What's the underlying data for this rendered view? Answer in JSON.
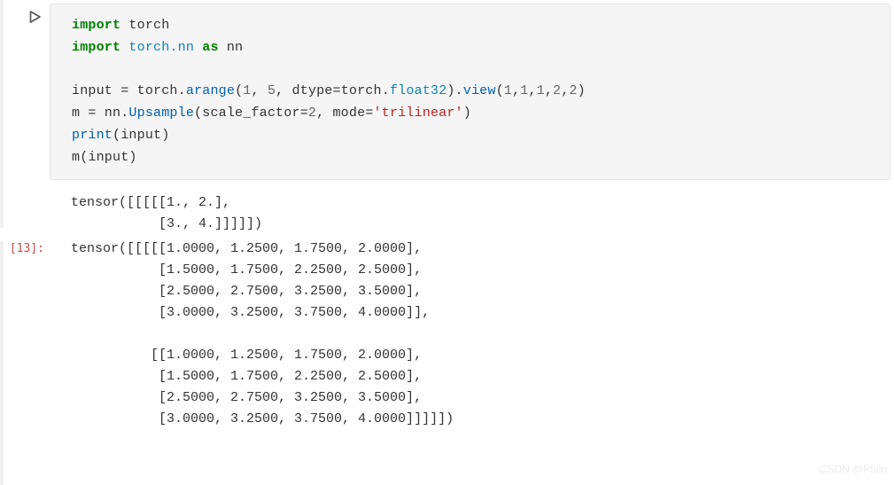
{
  "code": {
    "lines": [
      {
        "segments": [
          {
            "t": "import ",
            "c": "k-import"
          },
          {
            "t": "torch",
            "c": "plain"
          }
        ]
      },
      {
        "segments": [
          {
            "t": "import ",
            "c": "k-import"
          },
          {
            "t": "torch.nn",
            "c": "mod"
          },
          {
            "t": " ",
            "c": "plain"
          },
          {
            "t": "as",
            "c": "k-as"
          },
          {
            "t": " nn",
            "c": "plain"
          }
        ]
      },
      {
        "segments": [
          {
            "t": "",
            "c": "plain"
          }
        ]
      },
      {
        "segments": [
          {
            "t": "input ",
            "c": "plain"
          },
          {
            "t": "=",
            "c": "plain"
          },
          {
            "t": " torch",
            "c": "plain"
          },
          {
            "t": ".",
            "c": "plain"
          },
          {
            "t": "arange",
            "c": "func"
          },
          {
            "t": "(",
            "c": "plain"
          },
          {
            "t": "1",
            "c": "num"
          },
          {
            "t": ", ",
            "c": "plain"
          },
          {
            "t": "5",
            "c": "num"
          },
          {
            "t": ", dtype",
            "c": "plain"
          },
          {
            "t": "=",
            "c": "plain"
          },
          {
            "t": "torch",
            "c": "plain"
          },
          {
            "t": ".",
            "c": "plain"
          },
          {
            "t": "float32",
            "c": "attr"
          },
          {
            "t": ")",
            "c": "plain"
          },
          {
            "t": ".",
            "c": "plain"
          },
          {
            "t": "view",
            "c": "func"
          },
          {
            "t": "(",
            "c": "plain"
          },
          {
            "t": "1",
            "c": "num"
          },
          {
            "t": ",",
            "c": "plain"
          },
          {
            "t": "1",
            "c": "num"
          },
          {
            "t": ",",
            "c": "plain"
          },
          {
            "t": "1",
            "c": "num"
          },
          {
            "t": ",",
            "c": "plain"
          },
          {
            "t": "2",
            "c": "num"
          },
          {
            "t": ",",
            "c": "plain"
          },
          {
            "t": "2",
            "c": "num"
          },
          {
            "t": ")",
            "c": "plain"
          }
        ]
      },
      {
        "segments": [
          {
            "t": "m ",
            "c": "plain"
          },
          {
            "t": "=",
            "c": "plain"
          },
          {
            "t": " nn",
            "c": "plain"
          },
          {
            "t": ".",
            "c": "plain"
          },
          {
            "t": "Upsample",
            "c": "classname"
          },
          {
            "t": "(scale_factor",
            "c": "plain"
          },
          {
            "t": "=",
            "c": "plain"
          },
          {
            "t": "2",
            "c": "num"
          },
          {
            "t": ", mode",
            "c": "plain"
          },
          {
            "t": "=",
            "c": "plain"
          },
          {
            "t": "'trilinear'",
            "c": "str"
          },
          {
            "t": ")",
            "c": "plain"
          }
        ]
      },
      {
        "segments": [
          {
            "t": "print",
            "c": "func"
          },
          {
            "t": "(input)",
            "c": "plain"
          }
        ]
      },
      {
        "segments": [
          {
            "t": "m(input)",
            "c": "plain"
          }
        ]
      }
    ]
  },
  "output_print": [
    "tensor([[[[[1., 2.],",
    "           [3., 4.]]]]])"
  ],
  "out_prompt": "[13]:",
  "output_result": [
    "tensor([[[[[1.0000, 1.2500, 1.7500, 2.0000],",
    "           [1.5000, 1.7500, 2.2500, 2.5000],",
    "           [2.5000, 2.7500, 3.2500, 3.5000],",
    "           [3.0000, 3.2500, 3.7500, 4.0000]],",
    "",
    "          [[1.0000, 1.2500, 1.7500, 2.0000],",
    "           [1.5000, 1.7500, 2.2500, 2.5000],",
    "           [2.5000, 2.7500, 3.2500, 3.5000],",
    "           [3.0000, 3.2500, 3.7500, 4.0000]]]]])"
  ],
  "watermark": "CSDN @Philo"
}
